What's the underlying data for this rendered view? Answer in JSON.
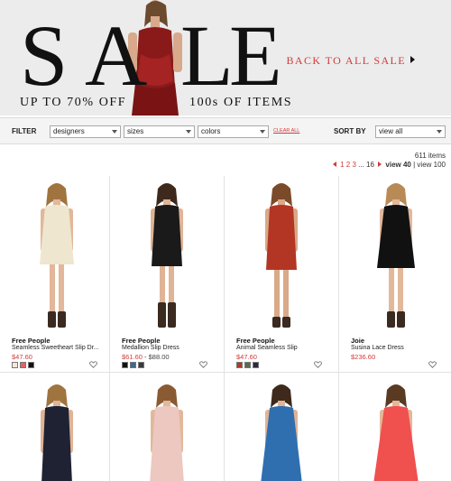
{
  "hero": {
    "letters": [
      "S",
      "A",
      "L",
      "E"
    ],
    "discount": "UP TO 70% OFF",
    "items_text": "100s OF ITEMS",
    "back_link": "BACK TO ALL SALE"
  },
  "filter": {
    "label": "FILTER",
    "designers": "designers",
    "sizes": "sizes",
    "colors": "colors",
    "clear_all": "CLEAR ALL",
    "sort_label": "SORT BY",
    "sort_value": "view all"
  },
  "pagination": {
    "count": "611 items",
    "page1": "1",
    "page2": "2",
    "page3": "3",
    "ellipsis": "...",
    "last_page": "16",
    "view40": "view 40",
    "separator": "|",
    "view100": "view 100"
  },
  "products": [
    {
      "brand": "Free People",
      "name": "Seamless Sweetheart Slip Dr...",
      "price": "$47.60",
      "swatches": [
        "#f4e9d8",
        "#e46464",
        "#111111"
      ],
      "dress_color": "#efe6cf"
    },
    {
      "brand": "Free People",
      "name": "Medallion Slip Dress",
      "price": "$61.60",
      "price_orig": "$88.00",
      "price_sep": " - ",
      "swatches": [
        "#111111",
        "#3c6a8c",
        "#3a3a3a"
      ],
      "dress_color": "#1a1a1a"
    },
    {
      "brand": "Free People",
      "name": "Animal Seamless Slip",
      "price": "$47.60",
      "swatches": [
        "#b03a22",
        "#5a6b4a",
        "#2a2a3a"
      ],
      "dress_color": "#b33524"
    },
    {
      "brand": "Joie",
      "name": "Susina Lace Dress",
      "price": "$236.60",
      "swatches": [],
      "dress_color": "#111111"
    }
  ],
  "row2_colors": [
    "#1e2233",
    "#ecc8c0",
    "#2f6fb0",
    "#f0504e"
  ],
  "colors": {
    "accent": "#d23a3a",
    "banner_bg": "#ececec"
  }
}
